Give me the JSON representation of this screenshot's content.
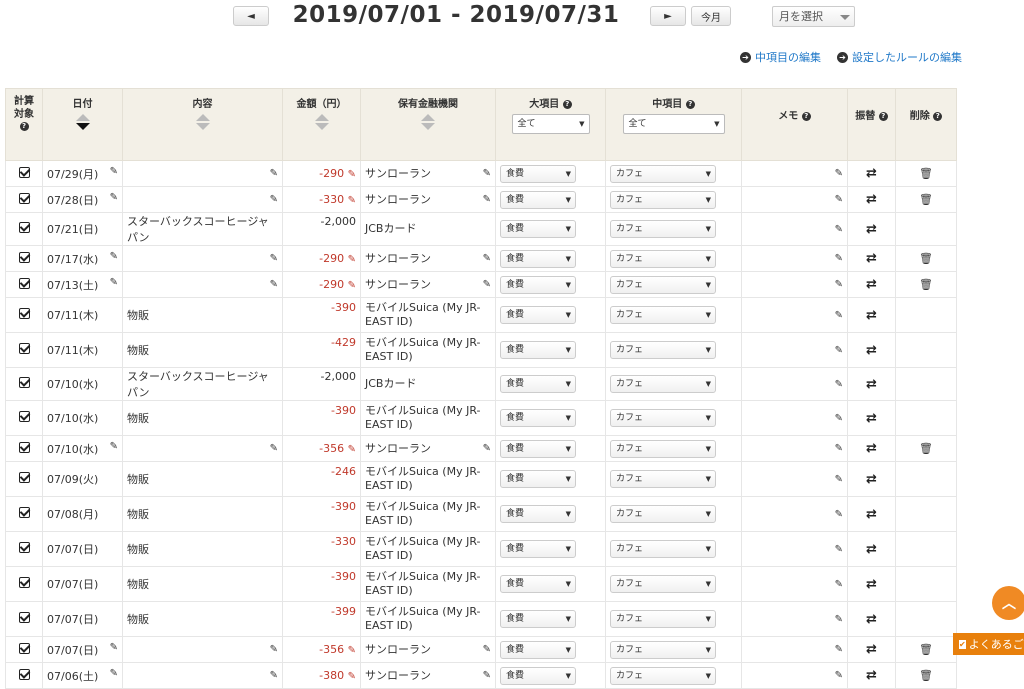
{
  "toolbar": {
    "prev_label": "◄",
    "next_label": "►",
    "today_label": "今月",
    "period": "2019/07/01 - 2019/07/31",
    "month_select": "月を選択"
  },
  "links": {
    "edit_middle": "中項目の編集",
    "edit_rules": "設定したルールの編集"
  },
  "headers": {
    "target": "計算対象",
    "date": "日付",
    "content": "内容",
    "amount": "金額（円）",
    "institution": "保有金融機関",
    "large": "大項目",
    "large_filter": "全て",
    "middle": "中項目",
    "middle_filter": "全て",
    "memo": "メモ",
    "transfer": "振替",
    "delete": "削除"
  },
  "rows": [
    {
      "date": "07/29(月)",
      "content": "",
      "amount": "-290",
      "inst": "サンローラン",
      "large": "食費",
      "middle": "カフェ",
      "editable": true,
      "deletable": true
    },
    {
      "date": "07/28(日)",
      "content": "",
      "amount": "-330",
      "inst": "サンローラン",
      "large": "食費",
      "middle": "カフェ",
      "editable": true,
      "deletable": true
    },
    {
      "date": "07/21(日)",
      "content": "スターバックスコーヒージャパン",
      "amount": "-2,000",
      "inst": "JCBカード",
      "large": "食費",
      "middle": "カフェ",
      "editable": false,
      "deletable": false
    },
    {
      "date": "07/17(水)",
      "content": "",
      "amount": "-290",
      "inst": "サンローラン",
      "large": "食費",
      "middle": "カフェ",
      "editable": true,
      "deletable": true
    },
    {
      "date": "07/13(土)",
      "content": "",
      "amount": "-290",
      "inst": "サンローラン",
      "large": "食費",
      "middle": "カフェ",
      "editable": true,
      "deletable": true
    },
    {
      "date": "07/11(木)",
      "content": "物販",
      "amount": "-390",
      "inst": "モバイルSuica (My JR-EAST ID)",
      "large": "食費",
      "middle": "カフェ",
      "editable": false,
      "deletable": false
    },
    {
      "date": "07/11(木)",
      "content": "物販",
      "amount": "-429",
      "inst": "モバイルSuica (My JR-EAST ID)",
      "large": "食費",
      "middle": "カフェ",
      "editable": false,
      "deletable": false
    },
    {
      "date": "07/10(水)",
      "content": "スターバックスコーヒージャパン",
      "amount": "-2,000",
      "inst": "JCBカード",
      "large": "食費",
      "middle": "カフェ",
      "editable": false,
      "deletable": false
    },
    {
      "date": "07/10(水)",
      "content": "物販",
      "amount": "-390",
      "inst": "モバイルSuica (My JR-EAST ID)",
      "large": "食費",
      "middle": "カフェ",
      "editable": false,
      "deletable": false
    },
    {
      "date": "07/10(水)",
      "content": "",
      "amount": "-356",
      "inst": "サンローラン",
      "large": "食費",
      "middle": "カフェ",
      "editable": true,
      "deletable": true
    },
    {
      "date": "07/09(火)",
      "content": "物販",
      "amount": "-246",
      "inst": "モバイルSuica (My JR-EAST ID)",
      "large": "食費",
      "middle": "カフェ",
      "editable": false,
      "deletable": false
    },
    {
      "date": "07/08(月)",
      "content": "物販",
      "amount": "-390",
      "inst": "モバイルSuica (My JR-EAST ID)",
      "large": "食費",
      "middle": "カフェ",
      "editable": false,
      "deletable": false
    },
    {
      "date": "07/07(日)",
      "content": "物販",
      "amount": "-330",
      "inst": "モバイルSuica (My JR-EAST ID)",
      "large": "食費",
      "middle": "カフェ",
      "editable": false,
      "deletable": false
    },
    {
      "date": "07/07(日)",
      "content": "物販",
      "amount": "-390",
      "inst": "モバイルSuica (My JR-EAST ID)",
      "large": "食費",
      "middle": "カフェ",
      "editable": false,
      "deletable": false
    },
    {
      "date": "07/07(日)",
      "content": "物販",
      "amount": "-399",
      "inst": "モバイルSuica (My JR-EAST ID)",
      "large": "食費",
      "middle": "カフェ",
      "editable": false,
      "deletable": false
    },
    {
      "date": "07/07(日)",
      "content": "",
      "amount": "-356",
      "inst": "サンローラン",
      "large": "食費",
      "middle": "カフェ",
      "editable": true,
      "deletable": true
    },
    {
      "date": "07/06(土)",
      "content": "",
      "amount": "-380",
      "inst": "サンローラン",
      "large": "食費",
      "middle": "カフェ",
      "editable": true,
      "deletable": true
    }
  ],
  "floating": {
    "to_top_icon": "chevron-up-icon",
    "faq_label": "よくあるご質問"
  }
}
